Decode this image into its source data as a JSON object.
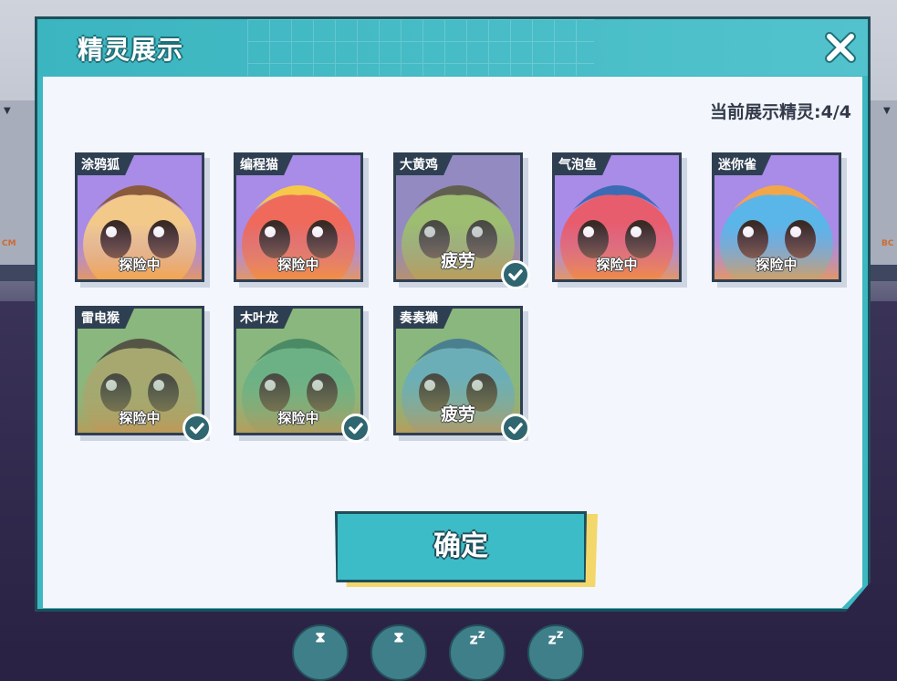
{
  "modal": {
    "title": "精灵展示",
    "count_label": "当前展示精灵:4/4",
    "confirm_label": "确定"
  },
  "background": {
    "tag_left": "CM",
    "tag_right": "BC"
  },
  "cards": [
    {
      "name": "涂鸦狐",
      "status": "探险中",
      "bg": "#a98be8",
      "selected": false,
      "faded": false
    },
    {
      "name": "编程猫",
      "status": "探险中",
      "bg": "#a98be8",
      "selected": false,
      "faded": false
    },
    {
      "name": "大黄鸡",
      "status": "疲劳",
      "bg": "#a98be8",
      "selected": true,
      "faded": true
    },
    {
      "name": "气泡鱼",
      "status": "探险中",
      "bg": "#a98be8",
      "selected": false,
      "faded": false
    },
    {
      "name": "迷你雀",
      "status": "探险中",
      "bg": "#a98be8",
      "selected": false,
      "faded": false
    },
    {
      "name": "雷电猴",
      "status": "探险中",
      "bg": "#9ccf7e",
      "selected": true,
      "faded": true
    },
    {
      "name": "木叶龙",
      "status": "探险中",
      "bg": "#9ccf7e",
      "selected": true,
      "faded": true
    },
    {
      "name": "奏奏獭",
      "status": "疲劳",
      "bg": "#9ccf7e",
      "selected": true,
      "faded": true
    }
  ],
  "colors": {
    "accent": "#3cb8c2",
    "dark": "#2f3f52",
    "confirm_shadow": "#f3d76a"
  }
}
